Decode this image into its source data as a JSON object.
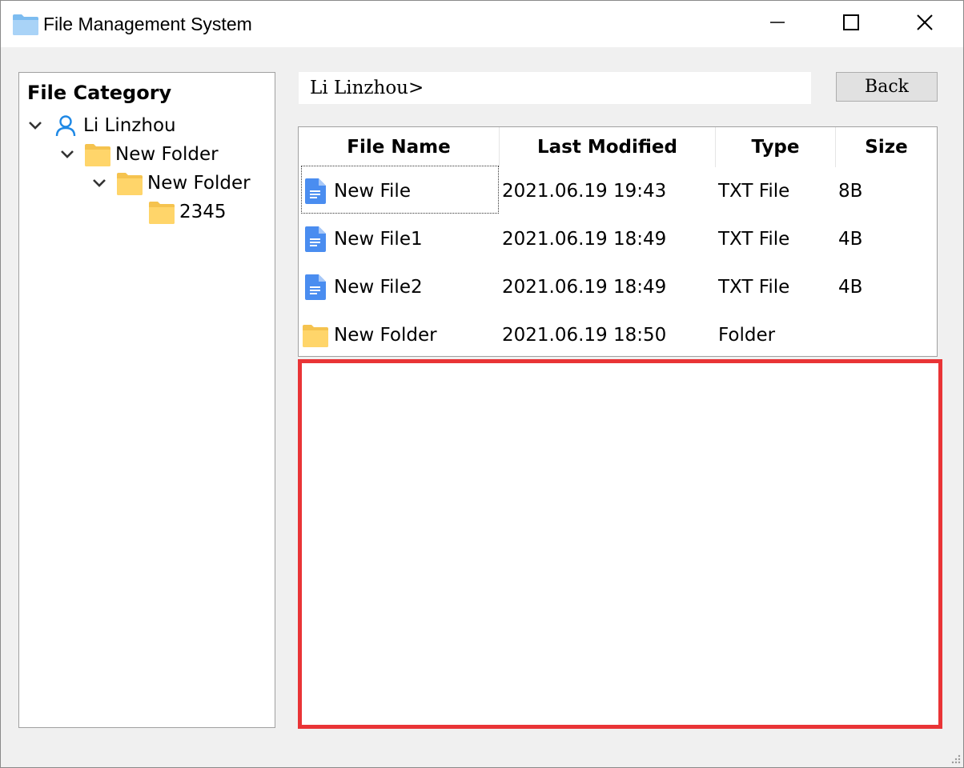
{
  "window": {
    "title": "File Management System",
    "icon": "folder-icon"
  },
  "tree": {
    "heading": "File Category",
    "nodes": [
      {
        "label": "Li Linzhou",
        "icon": "user-icon",
        "expanded": true,
        "level": 0
      },
      {
        "label": "New Folder",
        "icon": "folder-icon",
        "expanded": true,
        "level": 1
      },
      {
        "label": "New Folder",
        "icon": "folder-icon",
        "expanded": true,
        "level": 2
      },
      {
        "label": "2345",
        "icon": "folder-icon",
        "expanded": false,
        "level": 3
      }
    ]
  },
  "path_bar": {
    "text": "Li Linzhou>"
  },
  "back_button": {
    "label": "Back"
  },
  "table": {
    "columns": [
      "File Name",
      "Last Modified",
      "Type",
      "Size"
    ],
    "rows": [
      {
        "name": "New File",
        "modified": "2021.06.19 19:43",
        "type": "TXT File",
        "size": "8B",
        "icon": "document-icon"
      },
      {
        "name": "New File1",
        "modified": "2021.06.19 18:49",
        "type": "TXT File",
        "size": "4B",
        "icon": "document-icon"
      },
      {
        "name": "New File2",
        "modified": "2021.06.19 18:49",
        "type": "TXT File",
        "size": "4B",
        "icon": "document-icon"
      },
      {
        "name": "New Folder",
        "modified": "2021.06.19 18:50",
        "type": "Folder",
        "size": "",
        "icon": "folder-icon"
      }
    ]
  },
  "colors": {
    "folder": "#ffd56a",
    "document": "#4a8df0",
    "user": "#1e88e5",
    "highlight": "#e93436"
  }
}
